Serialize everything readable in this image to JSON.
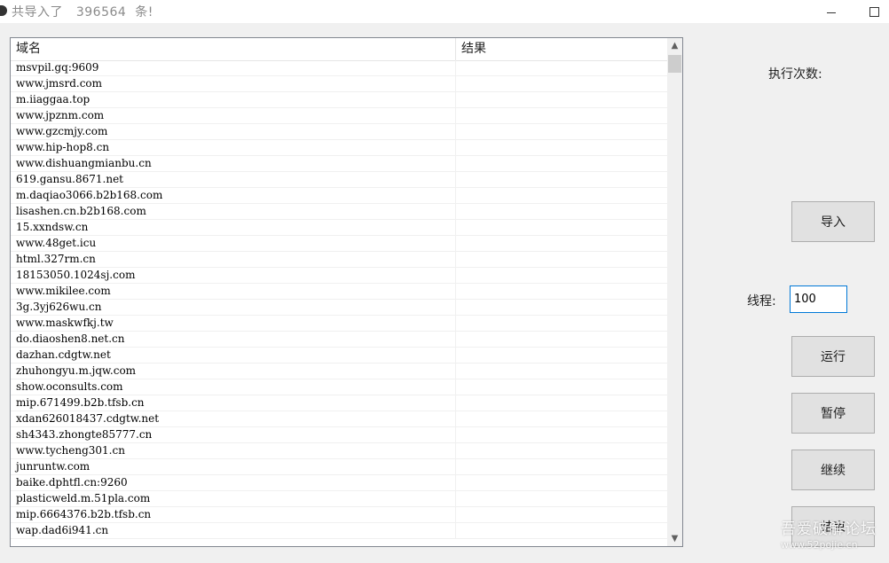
{
  "window": {
    "title": "共导入了   396564  条!",
    "minimize_label": "",
    "maximize_label": ""
  },
  "list": {
    "columns": [
      "域名",
      "结果"
    ],
    "rows": [
      [
        "msvpil.gq:9609",
        ""
      ],
      [
        "www.jmsrd.com",
        ""
      ],
      [
        "m.iiaggaa.top",
        ""
      ],
      [
        "www.jpznm.com",
        ""
      ],
      [
        "www.gzcmjy.com",
        ""
      ],
      [
        "www.hip-hop8.cn",
        ""
      ],
      [
        "www.dishuangmianbu.cn",
        ""
      ],
      [
        "619.gansu.8671.net",
        ""
      ],
      [
        "m.daqiao3066.b2b168.com",
        ""
      ],
      [
        "lisashen.cn.b2b168.com",
        ""
      ],
      [
        "15.xxndsw.cn",
        ""
      ],
      [
        "www.48get.icu",
        ""
      ],
      [
        "html.327rm.cn",
        ""
      ],
      [
        "18153050.1024sj.com",
        ""
      ],
      [
        "www.mikilee.com",
        ""
      ],
      [
        "3g.3yj626wu.cn",
        ""
      ],
      [
        "www.maskwfkj.tw",
        ""
      ],
      [
        "do.diaoshen8.net.cn",
        ""
      ],
      [
        "dazhan.cdgtw.net",
        ""
      ],
      [
        "zhuhongyu.m.jqw.com",
        ""
      ],
      [
        "show.oconsults.com",
        ""
      ],
      [
        "mip.671499.b2b.tfsb.cn",
        ""
      ],
      [
        "xdan626018437.cdgtw.net",
        ""
      ],
      [
        "sh4343.zhongte85777.cn",
        ""
      ],
      [
        "www.tycheng301.cn",
        ""
      ],
      [
        "junruntw.com",
        ""
      ],
      [
        "baike.dphtfl.cn:9260",
        ""
      ],
      [
        "plasticweld.m.51pla.com",
        ""
      ],
      [
        "mip.6664376.b2b.tfsb.cn",
        ""
      ],
      [
        "wap.dad6i941.cn",
        ""
      ]
    ]
  },
  "sidebar": {
    "exec_count_label": "执行次数:",
    "thread_label": "线程:",
    "thread_value": "100",
    "buttons": {
      "import": "导入",
      "run": "运行",
      "pause": "暂停",
      "continue": "继续",
      "stop": "结束"
    }
  },
  "watermark": {
    "line1": "吾爱破解论坛",
    "line2": "www.52pojie.cn"
  },
  "colors": {
    "window_bg": "#f0f0f0",
    "input_focus_border": "#0078d7",
    "button_bg": "#e1e1e1"
  }
}
